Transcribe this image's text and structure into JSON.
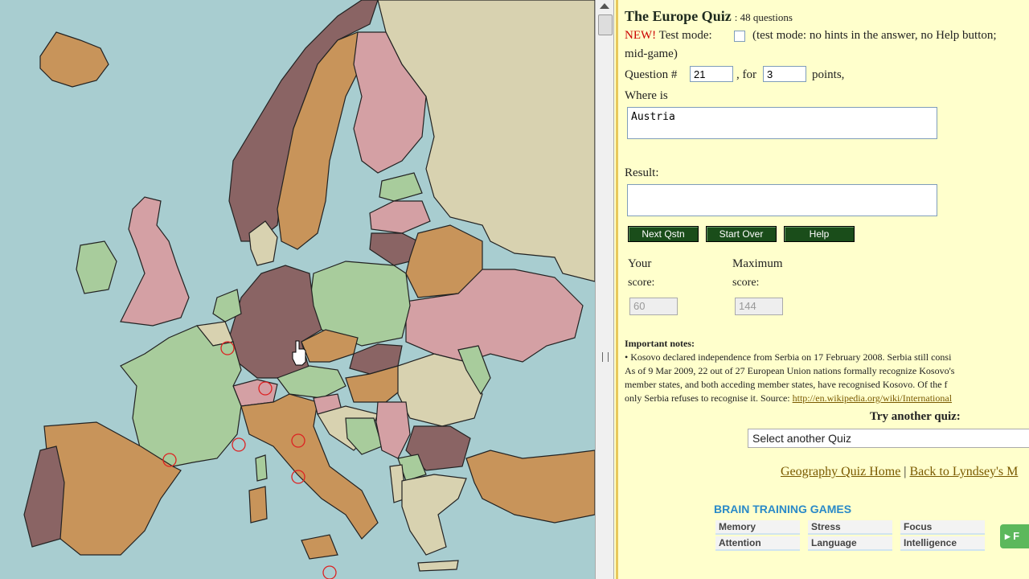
{
  "quiz": {
    "title": "The Europe Quiz",
    "question_count": ": 48 questions",
    "new_label": "NEW!",
    "test_mode_label": "Test mode:",
    "test_mode_note": "(test mode: no hints in the answer, no Help button;",
    "test_mode_note_2": "mid-game)",
    "question_label": "Question #",
    "question_number": "21",
    "for_label": ", for",
    "points_value": "3",
    "points_label": "points,",
    "where_label": "Where is",
    "where_value": "Austria",
    "result_label": "Result:",
    "result_value": ""
  },
  "buttons": {
    "next": "Next Qstn",
    "start_over": "Start Over",
    "help": "Help"
  },
  "score": {
    "your_label_1": "Your",
    "your_label_2": "score:",
    "your_value": "60",
    "max_label_1": "Maximum",
    "max_label_2": "score:",
    "max_value": "144"
  },
  "notes": {
    "heading": "Important notes:",
    "line1": "• Kosovo declared independence from Serbia on 17 February 2008. Serbia still consi",
    "line2": "As of 9 Mar 2009, 22 out of 27 European Union nations formally recognize Kosovo's",
    "line3": "member states, and both acceding member states, have recognised Kosovo. Of the f",
    "line4_text": "only Serbia refuses to recognise it. Source: ",
    "line4_link": "http://en.wikipedia.org/wiki/International"
  },
  "another": {
    "heading": "Try another quiz:",
    "select_value": "Select another Quiz"
  },
  "footer_links": {
    "home": "Geography Quiz Home",
    "separator": "|",
    "back": "Back to Lyndsey's M"
  },
  "ad": {
    "title": "BRAIN TRAINING GAMES",
    "items": [
      "Memory",
      "Stress",
      "Focus",
      "Attention",
      "Language",
      "Intelligence"
    ],
    "go": "F"
  },
  "colors": {
    "sea": "#a8cdd0",
    "panel_bg": "#ffffcc",
    "button_bg": "#1a4d1a",
    "marker": "#dd2222"
  }
}
